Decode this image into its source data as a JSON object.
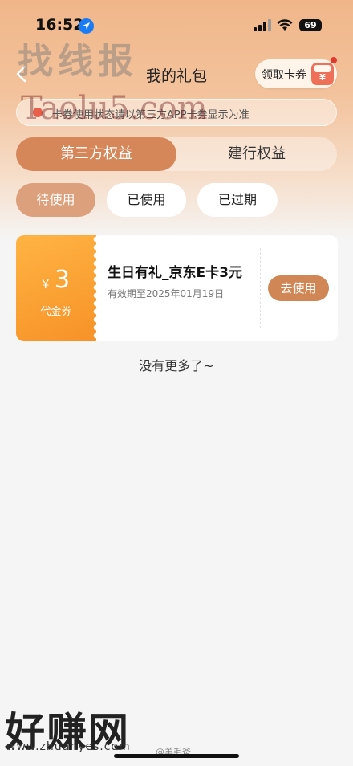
{
  "status_bar": {
    "time": "16:52",
    "battery": "69"
  },
  "nav": {
    "title": "我的礼包",
    "claim_label": "领取卡券",
    "gift_icon_glyph": "¥"
  },
  "notice": {
    "text": "卡券使用状态请以第三方APP卡券显示为准"
  },
  "tabs": [
    {
      "label": "第三方权益",
      "active": true
    },
    {
      "label": "建行权益",
      "active": false
    }
  ],
  "filters": [
    {
      "label": "待使用",
      "selected": true
    },
    {
      "label": "已使用",
      "selected": false
    },
    {
      "label": "已过期",
      "selected": false
    }
  ],
  "coupon": {
    "currency": "¥",
    "amount": "3",
    "kind": "代金券",
    "title": "生日有礼_京东E卡3元",
    "validity": "有效期至2025年01月19日",
    "action": "去使用"
  },
  "footer": {
    "no_more": "没有更多了~"
  },
  "watermarks": {
    "top_cn": "找线报",
    "top_en": "Taolu5.com",
    "bottom_cn": "好赚网",
    "bottom_url": "www.zhuanyes.com",
    "bottom_handle": "@羊毛爸"
  },
  "colors": {
    "accent": "#d5875a",
    "coupon_orange": "#f79228",
    "use_button": "#d08755"
  }
}
